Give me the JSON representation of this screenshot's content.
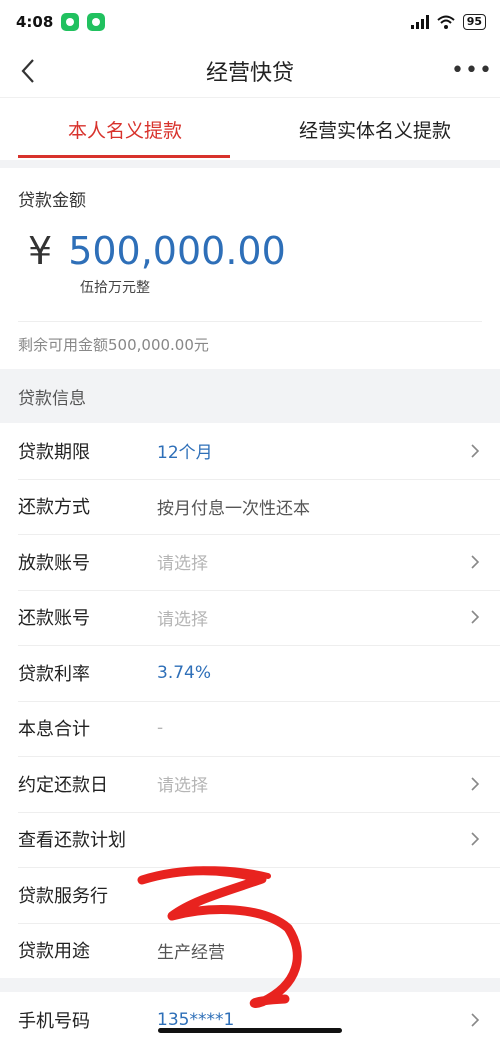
{
  "status": {
    "time": "4:08",
    "battery": "95"
  },
  "nav": {
    "title": "经营快贷"
  },
  "tabs": [
    {
      "label": "本人名义提款",
      "active": true
    },
    {
      "label": "经营实体名义提款",
      "active": false
    }
  ],
  "amount": {
    "label": "贷款金额",
    "currency": "¥",
    "value": "500,000.00",
    "words": "伍拾万元整",
    "remaining": "剩余可用金额500,000.00元"
  },
  "section_title": "贷款信息",
  "rows": [
    {
      "label": "贷款期限",
      "value": "12个月"
    },
    {
      "label": "还款方式",
      "value": "按月付息一次性还本"
    },
    {
      "label": "放款账号",
      "value": "请选择"
    },
    {
      "label": "还款账号",
      "value": "请选择"
    },
    {
      "label": "贷款利率",
      "value": "3.74%"
    },
    {
      "label": "本息合计",
      "value": "-"
    },
    {
      "label": "约定还款日",
      "value": "请选择"
    },
    {
      "label": "查看还款计划",
      "value": ""
    },
    {
      "label": "贷款服务行",
      "value": ""
    },
    {
      "label": "贷款用途",
      "value": "生产经营"
    }
  ],
  "phone_row": {
    "label": "手机号码",
    "value": "135****1"
  },
  "colors": {
    "accent_red": "#d8322c",
    "value_blue": "#2e6fb8",
    "scribble_red": "#e8231f"
  }
}
